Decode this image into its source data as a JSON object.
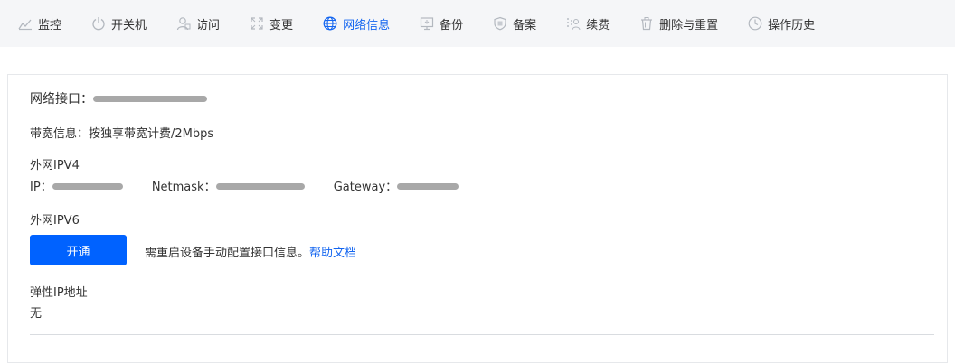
{
  "tabs": [
    {
      "label": "监控",
      "icon": "chart-line-icon",
      "active": false
    },
    {
      "label": "开关机",
      "icon": "power-icon",
      "active": false
    },
    {
      "label": "访问",
      "icon": "user-access-icon",
      "active": false
    },
    {
      "label": "变更",
      "icon": "expand-arrows-icon",
      "active": false
    },
    {
      "label": "网络信息",
      "icon": "globe-icon",
      "active": true
    },
    {
      "label": "备份",
      "icon": "monitor-backup-icon",
      "active": false
    },
    {
      "label": "备案",
      "icon": "shield-icon",
      "active": false
    },
    {
      "label": "续费",
      "icon": "renew-icon",
      "active": false
    },
    {
      "label": "删除与重置",
      "icon": "trash-icon",
      "active": false
    },
    {
      "label": "操作历史",
      "icon": "clock-icon",
      "active": false
    }
  ],
  "colors": {
    "accent": "#1466f0",
    "button": "#0062ff",
    "tabbar_bg": "#f5f6f8",
    "border": "#e6e8eb"
  },
  "network": {
    "interface_label": "网络接口：",
    "bandwidth_label": "带宽信息：",
    "bandwidth_value": "按独享带宽计费/2Mbps",
    "ipv4": {
      "heading": "外网IPV4",
      "ip_label": "IP：",
      "netmask_label": "Netmask：",
      "gateway_label": "Gateway："
    },
    "ipv6": {
      "heading": "外网IPV6",
      "enable_button": "开通",
      "hint": "需重启设备手动配置接口信息。",
      "help_link": "帮助文档"
    },
    "eip": {
      "heading": "弹性IP地址",
      "value": "无"
    }
  }
}
